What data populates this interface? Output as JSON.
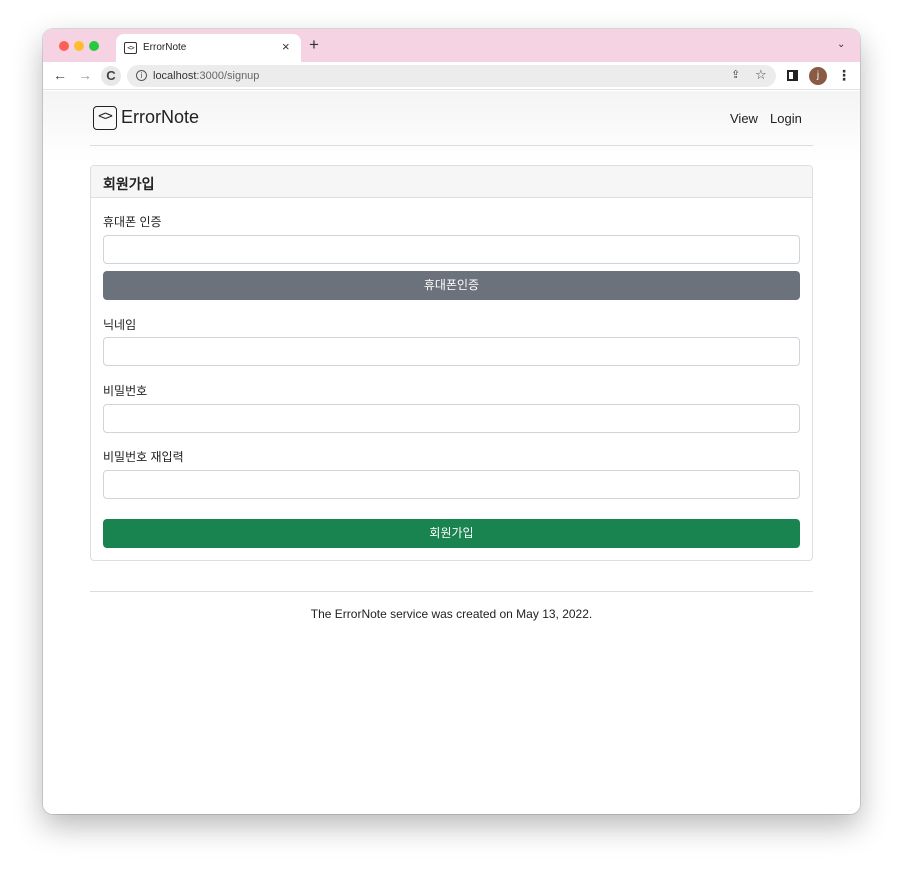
{
  "browser": {
    "tab_title": "ErrorNote",
    "tab_icon": "<>",
    "tab_close": "×",
    "new_tab": "+",
    "tab_menu": "⌄",
    "back": "←",
    "forward": "→",
    "reload": "C",
    "url_host": "localhost",
    "url_rest": ":3000/signup",
    "share": "⇪",
    "star": "☆",
    "profile_initial": "j",
    "menu": "⋮",
    "colors": {
      "tabbar": "#f6d3e3"
    }
  },
  "header": {
    "brand_icon": "<>",
    "brand": "ErrorNote",
    "nav": [
      "View",
      "Login"
    ]
  },
  "signup": {
    "title": "회원가입",
    "phone_label": "휴대폰 인증",
    "phone_value": "",
    "phone_button": "휴대폰인증",
    "nickname_label": "닉네임",
    "nickname_value": "",
    "password_label": "비밀번호",
    "password_value": "",
    "password_confirm_label": "비밀번호 재입력",
    "password_confirm_value": "",
    "submit_label": "회원가입",
    "colors": {
      "phone_button": "#6c727c",
      "submit_button": "#19844f"
    }
  },
  "footer": {
    "text": "The ErrorNote service was created on May 13, 2022."
  }
}
